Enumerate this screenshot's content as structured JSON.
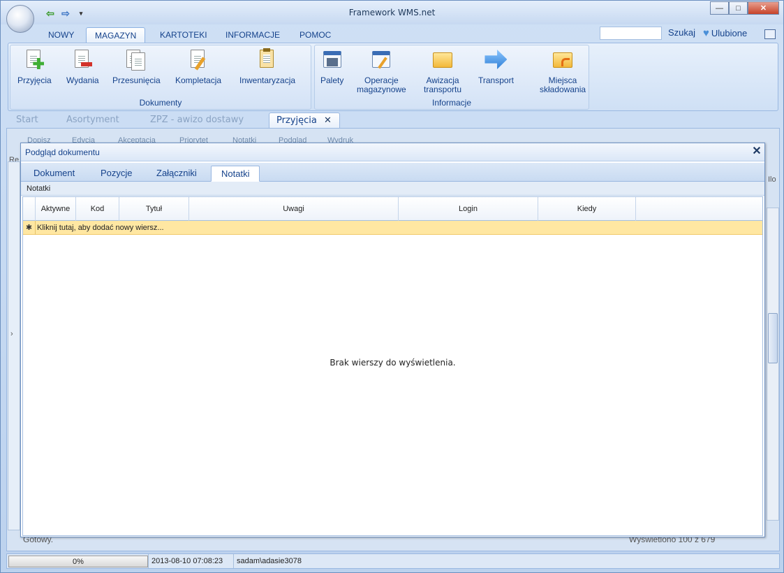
{
  "window": {
    "title": "Framework WMS.net"
  },
  "menu": {
    "tabs": [
      {
        "label": "NOWY"
      },
      {
        "label": "MAGAZYN"
      },
      {
        "label": "KARTOTEKI"
      },
      {
        "label": "INFORMACJE"
      },
      {
        "label": "POMOC"
      }
    ],
    "search_label": "Szukaj",
    "favorites_label": "Ulubione"
  },
  "ribbon": {
    "dokumenty": {
      "label": "Dokumenty",
      "buttons": [
        {
          "label": "Przyjęcia"
        },
        {
          "label": "Wydania"
        },
        {
          "label": "Przesunięcia"
        },
        {
          "label": "Kompletacja"
        },
        {
          "label": "Inwentaryzacja"
        }
      ]
    },
    "informacje": {
      "label": "Informacje",
      "buttons": [
        {
          "label": "Palety"
        },
        {
          "label_line1": "Operacje",
          "label_line2": "magazynowe"
        },
        {
          "label_line1": "Awizacja",
          "label_line2": "transportu"
        },
        {
          "label": "Transport"
        },
        {
          "label_line1": "Miejsca",
          "label_line2": "składowania"
        }
      ]
    }
  },
  "doc_tabs": [
    {
      "label": "Start"
    },
    {
      "label": "Asortyment"
    },
    {
      "label": "ZPZ - awizo dostawy"
    },
    {
      "label": "Przyjęcia"
    }
  ],
  "toolbar": {
    "items": [
      "Dopisz",
      "Edycja",
      "Akceptacja",
      "Priorytet",
      "Notatki",
      "Podgląd",
      "Wydruk"
    ]
  },
  "background": {
    "re_label": "Re",
    "ilo_label": "Ilo",
    "status": "Gotowy.",
    "count": "Wyświetlono 100 z 679"
  },
  "dialog": {
    "title": "Podgląd dokumentu",
    "tabs": [
      {
        "label": "Dokument"
      },
      {
        "label": "Pozycje"
      },
      {
        "label": "Załączniki"
      },
      {
        "label": "Notatki"
      }
    ],
    "section": "Notatki",
    "columns": [
      "Aktywne",
      "Kod",
      "Tytuł",
      "Uwagi",
      "Login",
      "Kiedy"
    ],
    "new_row": "Kliknij tutaj, aby dodać nowy wiersz...",
    "empty": "Brak wierszy do wyświetlenia."
  },
  "statusbar": {
    "progress": "0%",
    "progress_value": 0,
    "datetime": "2013-08-10 07:08:23",
    "user": "sadam\\adasie3078"
  }
}
